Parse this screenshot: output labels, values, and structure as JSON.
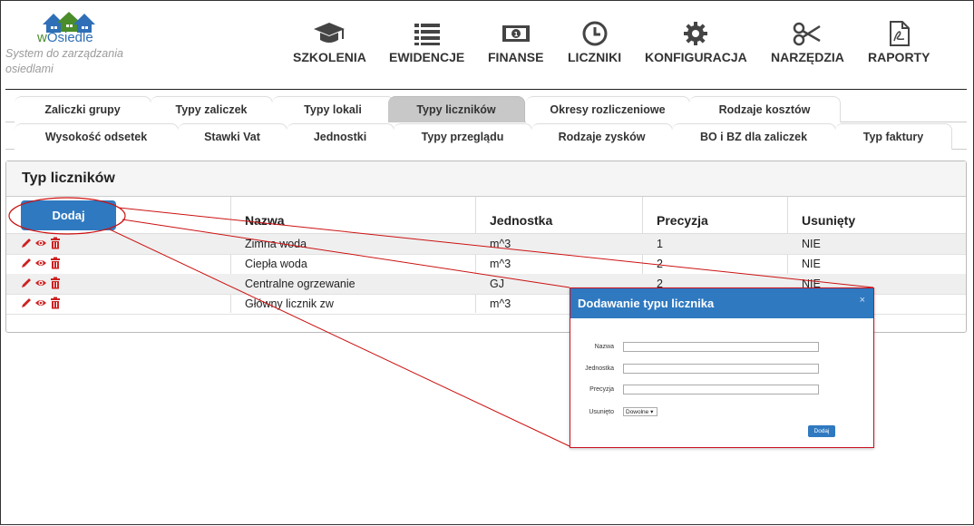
{
  "app": {
    "brand_prefix": "w",
    "brand_name": "Osiedle",
    "tagline": "System do zarządzania osiedlami"
  },
  "nav": [
    {
      "label": "SZKOLENIA",
      "icon": "graduation-cap-icon"
    },
    {
      "label": "EWIDENCJE",
      "icon": "list-icon"
    },
    {
      "label": "FINANSE",
      "icon": "banknote-icon"
    },
    {
      "label": "LICZNIKI",
      "icon": "clock-icon"
    },
    {
      "label": "KONFIGURACJA",
      "icon": "gear-icon"
    },
    {
      "label": "NARZĘDZIA",
      "icon": "scissors-icon"
    },
    {
      "label": "RAPORTY",
      "icon": "pdf-file-icon"
    }
  ],
  "tabs_row1": [
    "Zaliczki grupy",
    "Typy zaliczek",
    "Typy lokali",
    "Typy liczników",
    "Okresy rozliczeniowe",
    "Rodzaje kosztów"
  ],
  "tabs_row2": [
    "Wysokość odsetek",
    "Stawki Vat",
    "Jednostki",
    "Typy przeglądu",
    "Rodzaje zysków",
    "BO i BZ dla zaliczek",
    "Typ faktury"
  ],
  "active_tab": "Typy liczników",
  "panel": {
    "title": "Typ liczników",
    "add_button": "Dodaj"
  },
  "table": {
    "columns": [
      "Nazwa",
      "Jednostka",
      "Precyzja",
      "Usunięty"
    ],
    "rows": [
      [
        "Zimna woda",
        "m^3",
        "1",
        "NIE"
      ],
      [
        "Ciepła woda",
        "m^3",
        "2",
        "NIE"
      ],
      [
        "Centralne ogrzewanie",
        "GJ",
        "2",
        "NIE"
      ],
      [
        "Główny licznik zw",
        "m^3",
        "",
        ""
      ]
    ]
  },
  "dialog": {
    "title": "Dodawanie typu licznika",
    "close": "×",
    "fields": [
      {
        "label": "Nazwa",
        "value": ""
      },
      {
        "label": "Jednostka",
        "value": ""
      },
      {
        "label": "Precyzja",
        "value": ""
      }
    ],
    "select_label": "Usunięto",
    "select_value": "Dowolne ▾",
    "submit": "Dodaj"
  },
  "colors": {
    "primary": "#2f79c0",
    "annotation": "#cc1111",
    "action_icons": "#cc2222"
  }
}
